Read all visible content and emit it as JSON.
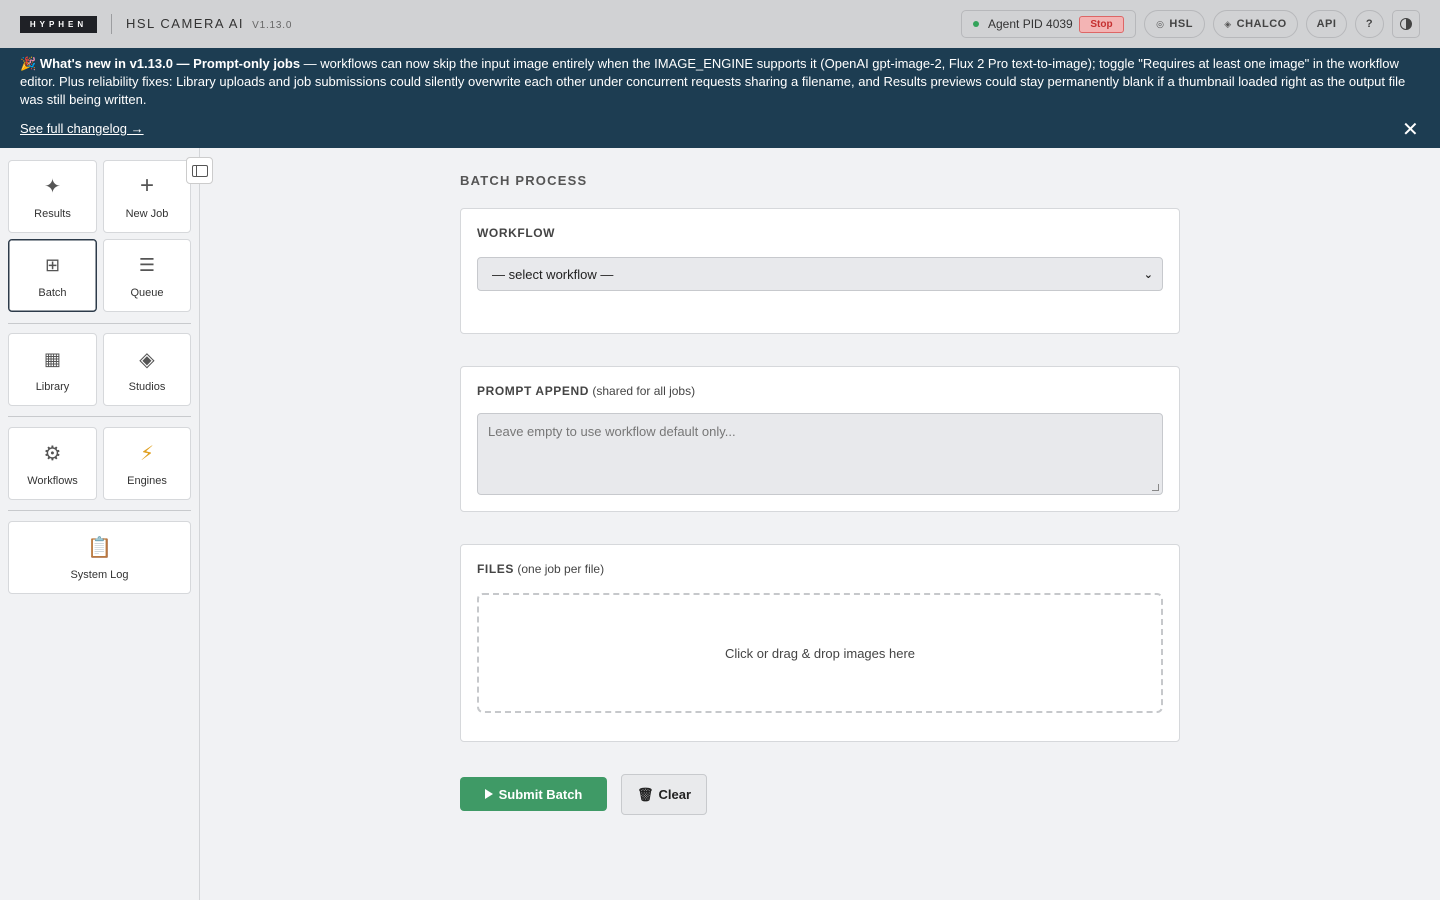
{
  "header": {
    "logo_text": "HYPHEN",
    "app_name": "HSL CAMERA AI",
    "version": "V1.13.0",
    "agent_label": "Agent PID 4039",
    "stop_label": "Stop",
    "hsl_label": "HSL",
    "chalco_label": "CHALCO",
    "api_label": "API",
    "help_label": "?"
  },
  "banner": {
    "emoji": "🎉",
    "headline": "What's new in v1.13.0 — Prompt-only jobs",
    "body": " — workflows can now skip the input image entirely when the IMAGE_ENGINE supports it (OpenAI gpt-image-2, Flux 2 Pro text-to-image); toggle \"Requires at least one image\" in the workflow editor. Plus reliability fixes: Library uploads and job submissions could silently overwrite each other under concurrent requests sharing a filename, and Results previews could stay permanently blank if a thumbnail loaded right as the output file was still being written.",
    "changelog_link": "See full changelog →",
    "close_symbol": "✕"
  },
  "sidebar": {
    "items": [
      {
        "label": "Results",
        "icon": "✦"
      },
      {
        "label": "New Job",
        "icon": "+"
      },
      {
        "label": "Batch",
        "icon": "⊞"
      },
      {
        "label": "Queue",
        "icon": "☰"
      },
      {
        "label": "Library",
        "icon": "▦"
      },
      {
        "label": "Studios",
        "icon": "◈"
      },
      {
        "label": "Workflows",
        "icon": "⚙"
      },
      {
        "label": "Engines",
        "icon": "⚡"
      },
      {
        "label": "System Log",
        "icon": "📋"
      }
    ],
    "active": "Batch"
  },
  "main": {
    "title": "BATCH PROCESS",
    "workflow": {
      "label": "WORKFLOW",
      "selected": "— select workflow —"
    },
    "prompt": {
      "label": "PROMPT APPEND",
      "note": "(shared for all jobs)",
      "placeholder": "Leave empty to use workflow default only..."
    },
    "files": {
      "label": "FILES",
      "note": "(one job per file)",
      "dropzone_text": "Click or drag & drop images here"
    },
    "submit_label": "Submit Batch",
    "clear_label": "Clear"
  },
  "colors": {
    "banner_bg": "#1d3d52",
    "submit_bg": "#3f9a66",
    "agent_status": "#33a35a",
    "stop": "#c53030"
  }
}
